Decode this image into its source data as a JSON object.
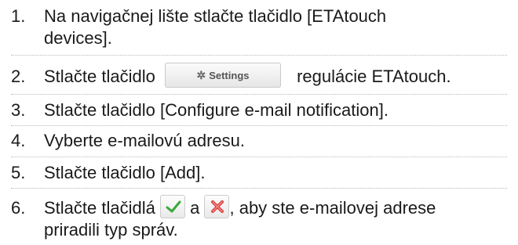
{
  "steps": [
    {
      "number": "1.",
      "text_line1": "Na navigačnej lište stlačte tlačidlo [ETAtouch",
      "text_line2": "devices]."
    },
    {
      "number": "2.",
      "text_before": "Stlačte tlačidlo",
      "button_label": "Settings",
      "text_after": "regulácie ETAtouch."
    },
    {
      "number": "3.",
      "text": "Stlačte tlačidlo [Configure e-mail notification]."
    },
    {
      "number": "4.",
      "text": "Vyberte e-mailovú adresu."
    },
    {
      "number": "5.",
      "text": "Stlačte tlačidlo [Add]."
    },
    {
      "number": "6.",
      "text_before": "Stlačte tlačidlá",
      "text_between": "a",
      "text_after": ", aby ste e-mailovej adrese",
      "text_line2": "priradili typ správ."
    }
  ],
  "icons": {
    "settings": "gear-icon",
    "confirm": "check-icon",
    "remove": "cross-icon"
  },
  "colors": {
    "check": "#3aa83a",
    "cross": "#d93b3b"
  }
}
